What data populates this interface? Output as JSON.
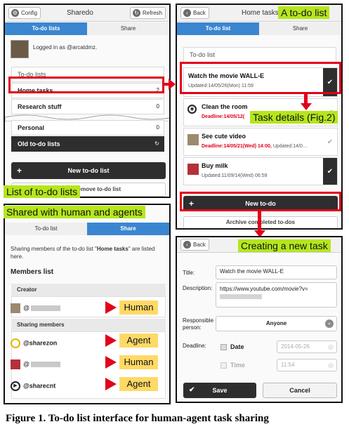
{
  "panel1": {
    "config_label": "Config",
    "title": "Sharedo",
    "refresh_label": "Refresh",
    "tab_active": "To-do lists",
    "tab_inactive": "Share",
    "login_text": "Logged in as @arcatdmz.",
    "lists_header": "To-do lists",
    "lists": [
      {
        "name": "Home tasks",
        "count": "2"
      },
      {
        "name": "Research stuff",
        "count": "0"
      },
      {
        "name": "Personal",
        "count": "0"
      }
    ],
    "old_lists": "Old to-do lists",
    "new_list_button": "New to-do list",
    "edit_remove": "Edit or remove to-do list",
    "badge": "List of to-do lists"
  },
  "panel2": {
    "back_label": "Back",
    "title": "Home tasks",
    "tab_active": "To-do list",
    "tab_inactive": "Share",
    "list_header": "To-do list",
    "tasks": [
      {
        "title": "Watch the movie WALL-E",
        "meta": "Updated:14/05/26(Mon) 11:59",
        "deadline": ""
      },
      {
        "title": "Clean the room",
        "meta": "",
        "deadline": "Deadline:14/05/12("
      },
      {
        "title": "See cute video",
        "meta": "Updated:14/0…",
        "deadline": "Deadline:14/05/21(Wed) 14:00,"
      },
      {
        "title": "Buy milk",
        "meta": "Updated:11/09/14(Wed) 06:59",
        "deadline": ""
      }
    ],
    "new_todo_button": "New to-do",
    "archive": "Archive completed to-dos",
    "badge": "A to-do list",
    "details_badge": "Task details (Fig.2)"
  },
  "panel3": {
    "tab_inactive": "To-do list",
    "tab_active": "Share",
    "sharing_prefix": "Sharing members of the to-do list \"",
    "sharing_list": "Home tasks",
    "sharing_suffix": "\" are listed here.",
    "members_header": "Members list",
    "creator_header": "Creator",
    "sharing_header": "Sharing members",
    "members": [
      {
        "handle": "@",
        "tag": "Human"
      },
      {
        "handle": "@sharezon",
        "tag": "Agent"
      },
      {
        "handle": "@",
        "tag": "Human"
      },
      {
        "handle": "@sharecnt",
        "tag": "Agent"
      }
    ],
    "badge": "Shared with human and agents"
  },
  "panel4": {
    "back_label": "Back",
    "title_label": "Title:",
    "title_value": "Watch the movie WALL-E",
    "description_label": "Description:",
    "description_value": "https://www.youtube.com/movie?v=",
    "responsible_label": "Responsible person:",
    "responsible_value": "Anyone",
    "deadline_label": "Deadline:",
    "date_label": "Date",
    "date_value": "2014-05-26",
    "time_label": "Time",
    "time_value": "11:54",
    "save_button": "Save",
    "cancel_button": "Cancel",
    "badge": "Creating a new task"
  },
  "caption": "Figure 1. To-do list interface for human-agent task sharing",
  "colors": {
    "accent": "#3b86d0",
    "badge": "#b5e61d",
    "tag": "#ffd966",
    "highlight": "#e2001a",
    "dark": "#2e2e2e"
  }
}
